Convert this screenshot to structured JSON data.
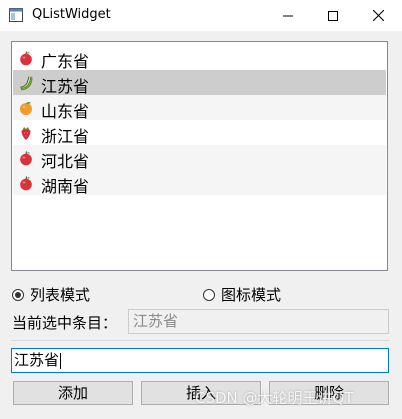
{
  "window": {
    "title": "QListWidget",
    "buttons": [
      "minimize",
      "maximize",
      "close"
    ]
  },
  "list": {
    "items": [
      {
        "label": "广东省",
        "icon": "apple-icon"
      },
      {
        "label": "江苏省",
        "icon": "banana-icon"
      },
      {
        "label": "山东省",
        "icon": "orange-icon"
      },
      {
        "label": "浙江省",
        "icon": "strawberry-icon"
      },
      {
        "label": "河北省",
        "icon": "apple-icon"
      },
      {
        "label": "湖南省",
        "icon": "apple-icon"
      }
    ],
    "selected_index": 1
  },
  "modes": {
    "list_mode_label": "列表模式",
    "icon_mode_label": "图标模式",
    "selected": "list"
  },
  "current": {
    "label": "当前选中条目：",
    "value": "江苏省"
  },
  "input": {
    "value": "江苏省"
  },
  "actions": {
    "add_label": "添加",
    "insert_label": "插入",
    "delete_label": "删除"
  },
  "watermark": "CSDN @大轮明王讲QT",
  "colors": {
    "selection": "#cdcdcd",
    "alternate_row": "#f5f5f5",
    "focus_border": "#0078d7"
  }
}
